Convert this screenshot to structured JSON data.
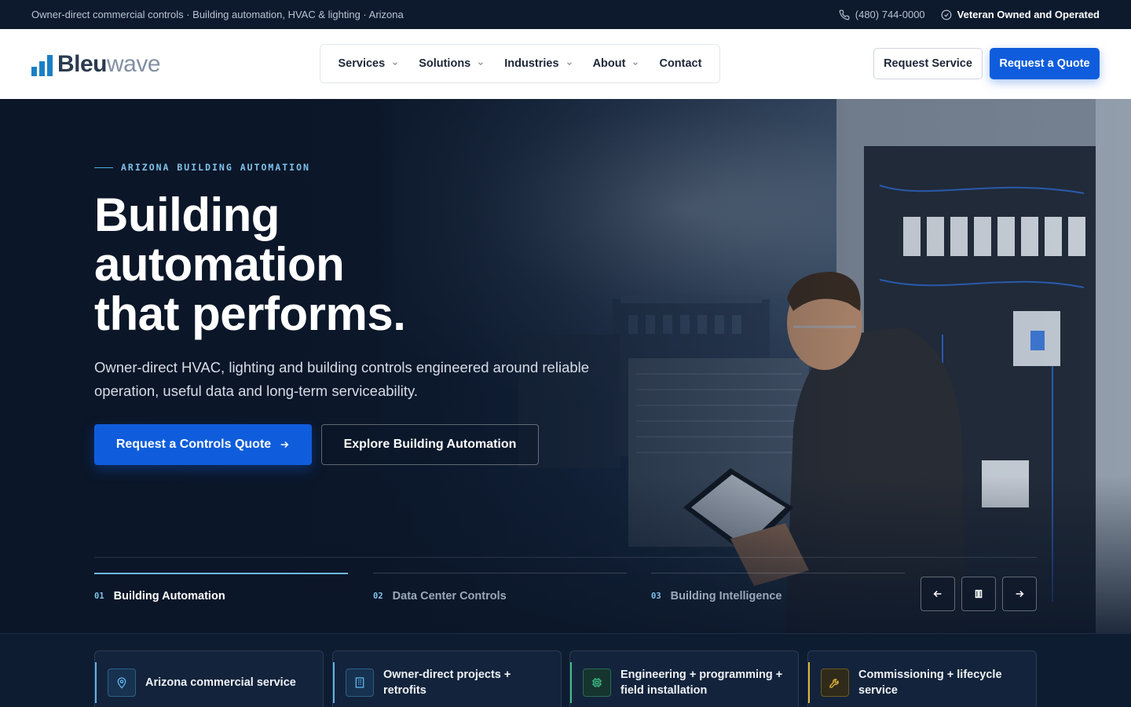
{
  "topbar": {
    "tagline": "Owner-direct commercial controls · Building automation, HVAC & lighting · Arizona",
    "phone": "(480) 744-0000",
    "badge": "Veteran Owned and Operated"
  },
  "header": {
    "logo_part1": "Bleu",
    "logo_part2": "wave",
    "nav": [
      {
        "label": "Services",
        "has_dropdown": true
      },
      {
        "label": "Solutions",
        "has_dropdown": true
      },
      {
        "label": "Industries",
        "has_dropdown": true
      },
      {
        "label": "About",
        "has_dropdown": true
      },
      {
        "label": "Contact",
        "has_dropdown": false
      }
    ],
    "request_service_label": "Request Service",
    "request_quote_label": "Request a Quote"
  },
  "hero": {
    "eyebrow": "ARIZONA BUILDING AUTOMATION",
    "title_lines": [
      "Building",
      "automation",
      "that performs."
    ],
    "subtitle": "Owner-direct HVAC, lighting and building controls engineered around reliable operation, useful data and long-term serviceability.",
    "primary_cta": "Request a Controls Quote",
    "secondary_cta": "Explore Building Automation",
    "slides": [
      {
        "num": "01",
        "name": "Building Automation",
        "active": true
      },
      {
        "num": "02",
        "name": "Data Center Controls",
        "active": false
      },
      {
        "num": "03",
        "name": "Building Intelligence",
        "active": false
      }
    ]
  },
  "features": [
    {
      "icon": "map-pin-icon",
      "text": "Arizona commercial service",
      "color": "#5fb3e6"
    },
    {
      "icon": "building-icon",
      "text": "Owner-direct projects + retrofits",
      "color": "#5fb3e6"
    },
    {
      "icon": "chip-icon",
      "text": "Engineering + programming + field installation",
      "color": "#3fc08a"
    },
    {
      "icon": "wrench-icon",
      "text": "Commissioning + lifecycle service",
      "color": "#e2b73a"
    }
  ],
  "colors": {
    "brand_blue": "#0f5ddc",
    "accent_cyan": "#7fc3ea",
    "dark_bg": "#0b1628"
  }
}
